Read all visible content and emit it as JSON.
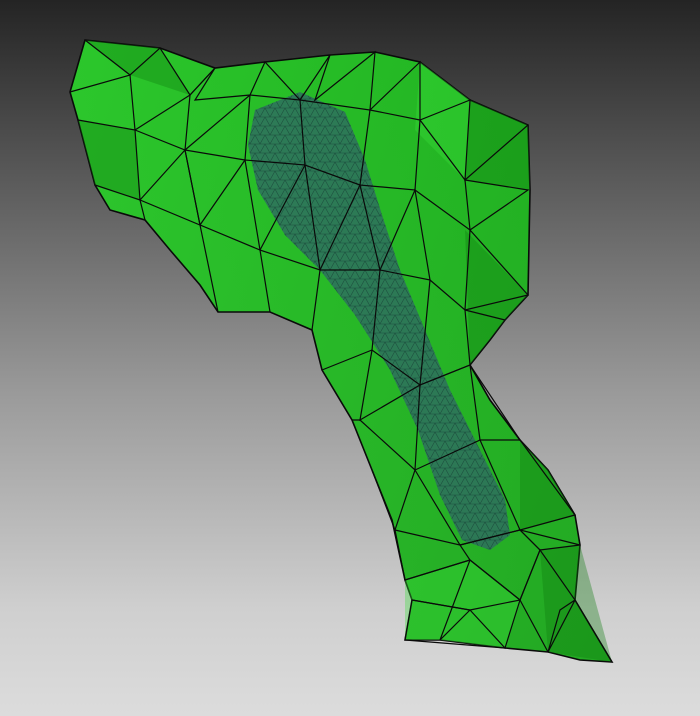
{
  "scene": {
    "mesh_color": "#1fc41f",
    "mesh_dark": "#0e7a0e",
    "mesh_light": "#39e039",
    "edge_color": "#0a0a0a",
    "inner_mesh_color": "#2e6e5e",
    "background_top": "#242424",
    "background_bottom": "#dcdcdc"
  }
}
